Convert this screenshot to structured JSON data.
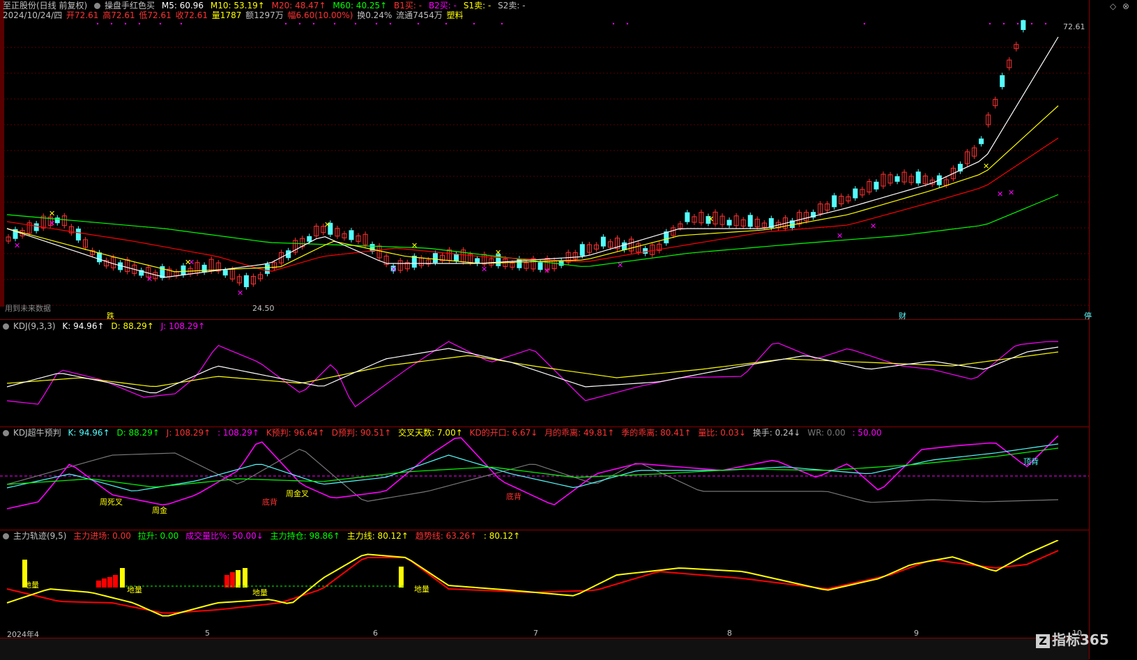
{
  "header": {
    "stock": "至正股份(日线 前复权)",
    "formula": "操盘手红色买",
    "m5": "M5: 60.96",
    "m10": "M10: 53.19↑",
    "m20": "M20: 48.47↑",
    "m60": "M60: 40.25↑",
    "b1": "B1买: -",
    "b2": "B2买: -",
    "s1": "S1卖: -",
    "s2": "S2卖: -"
  },
  "quote": {
    "date": "2024/10/24/四",
    "open": "开72.61",
    "high": "高72.61",
    "low": "低72.61",
    "close": "收72.61",
    "vol": "量1787",
    "amount": "额1297万",
    "change": "幅6.60(10.00%)",
    "turnover": "换0.24%",
    "float": "流通7454万",
    "sector": "塑料"
  },
  "main_panel": {
    "high_price": "72.61",
    "low_price": "24.50",
    "future_note": "用到未来数据",
    "tags": {
      "die": "跌",
      "cai": "财",
      "ting": "停"
    }
  },
  "kdj": {
    "title": "KDJ(9,3,3)",
    "k": "K: 94.96↑",
    "d": "D: 88.29↑",
    "j": "J: 108.29↑"
  },
  "kdj_bull": {
    "title": "KDJ超牛预判",
    "k": "K: 94.96↑",
    "d": "D: 88.29↑",
    "j": "J: 108.29↑",
    "j2": ": 108.29↑",
    "kpred": "K预判: 96.64↑",
    "dpred": "D预判: 90.51↑",
    "cross_days": "交叉天数: 7.00↑",
    "kd_open": "KD的开口: 6.67↓",
    "month_dev": "月的乖离: 49.81↑",
    "season_dev": "季的乖离: 80.41↑",
    "vol_ratio": "量比: 0.03↓",
    "turnover": "换手: 0.24↓",
    "wr": "WR: 0.00",
    "wr2": ": 50.00",
    "labels": {
      "death": "周死叉",
      "gold1": "周金",
      "gold2": "周金叉",
      "dibei1": "底背",
      "dibei2": "底背",
      "dingbei": "顶背"
    }
  },
  "main_force": {
    "title": "主力轨迹(9,5)",
    "enter": "主力进场: 0.00",
    "lift": "拉升: 0.00",
    "volratio": "成交量比%: 50.00↓",
    "hold": "主力持仓: 98.86↑",
    "line": "主力线: 80.12↑",
    "trend": "趋势线: 63.26↑",
    "v2": ": 80.12↑",
    "diliang": "地量"
  },
  "x_axis": [
    "2024年4",
    "5",
    "6",
    "7",
    "8",
    "9",
    "10"
  ],
  "watermark": "指标365",
  "colors": {
    "up": "#ff3232",
    "down": "#54fcfc",
    "m5": "#ffffff",
    "m10": "#ffff00",
    "m20": "#ff0000",
    "m60": "#00ff00",
    "magenta": "#ff00ff"
  }
}
